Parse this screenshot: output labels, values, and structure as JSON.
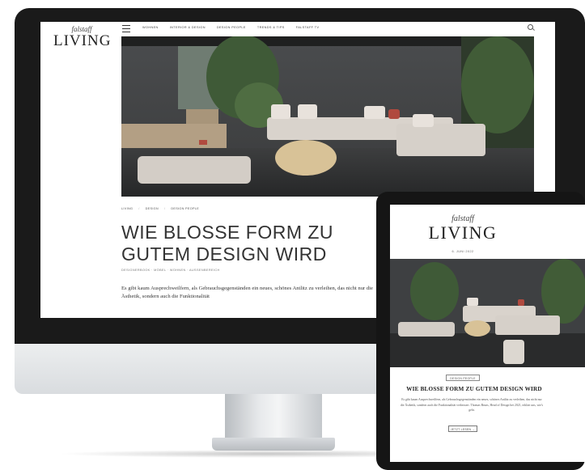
{
  "desktop": {
    "logo": {
      "small": "falstaff",
      "big": "LIVING"
    },
    "nav": [
      "WOHNEN",
      "INTERIOR & DESIGN",
      "DESIGN PEOPLE",
      "TRENDS & TIPS",
      "FALSTAFF TV"
    ],
    "breadcrumb": [
      "LIVING",
      "DESIGN",
      "DESIGN PEOPLE"
    ],
    "headline": "WIE BLOSSE FORM ZU GUTEM DESIGN WIRD",
    "tags": "DESIGNERBOOK · MÖBEL · WOHNEN · AUSSENBEREICH",
    "body": "Es gibt kaum Ausprechweilfern, als Gebrauchsgegenständen ein neues, schönes Antlitz zu verleihen, das nicht nur die Ästhetik, sondern auch die Funktionalität"
  },
  "tablet": {
    "logo": {
      "small": "falstaff",
      "big": "LIVING"
    },
    "date": "6. JUNI 2022",
    "category": "DESIGN PEOPLE",
    "title": "WIE BLOSSE FORM ZU GUTEM DESIGN WIRD",
    "body": "Es gibt kaum Ausprechweilfern, als Gebrauchsgegenständen ein neues, schönes Antlitz zu verleihen, das nicht nur die Ästhetik, sondern auch die Funktionalität verbessert. Thomas Bruns, Head of Design bei 2021, erklärt uns, wie's geht.",
    "button": "JETZT LESEN →"
  },
  "colors": {
    "frame": "#1a1a1a",
    "stand": "#d9dcdf",
    "text": "#333333"
  },
  "icons": [
    "hamburger-menu-icon",
    "search-icon"
  ]
}
